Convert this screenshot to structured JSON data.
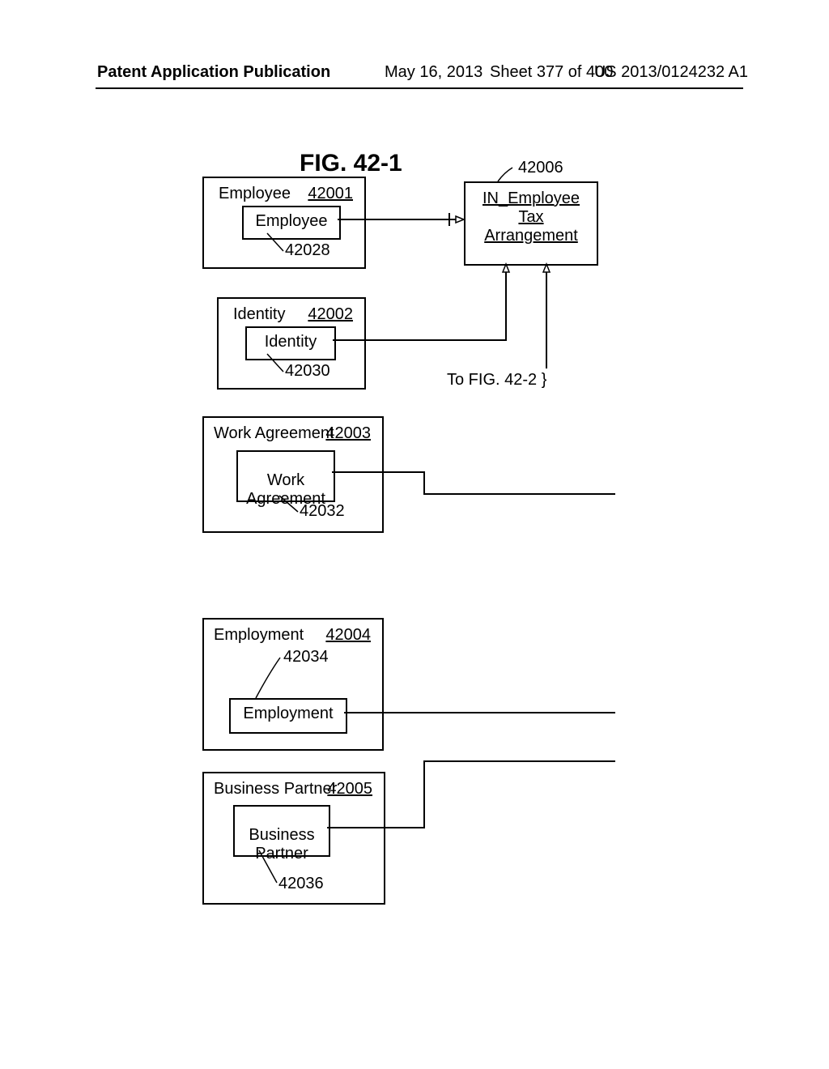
{
  "header": {
    "left": "Patent Application Publication",
    "date": "May 16, 2013",
    "sheet": "Sheet 377 of 400",
    "pubno": "US 2013/0124232 A1"
  },
  "figure_title": "FIG. 42-1",
  "cross_ref": "To FIG. 42-2 }",
  "blocks": {
    "employee": {
      "title": "Employee",
      "id": "42001",
      "inner": "Employee",
      "inner_id": "42028"
    },
    "identity": {
      "title": "Identity",
      "id": "42002",
      "inner": "Identity",
      "inner_id": "42030"
    },
    "work_agreement": {
      "title": "Work Agreement",
      "id": "42003",
      "inner": "Work\nAgreement",
      "inner_id": "42032"
    },
    "employment": {
      "title": "Employment",
      "id": "42004",
      "inner": "Employment",
      "inner_id": "42034"
    },
    "business_partner": {
      "title": "Business Partner",
      "id": "42005",
      "inner": "Business\nPartner",
      "inner_id": "42036"
    }
  },
  "right_block": {
    "title": "IN_Employee\nTax\nArrangement",
    "id": "42006"
  }
}
